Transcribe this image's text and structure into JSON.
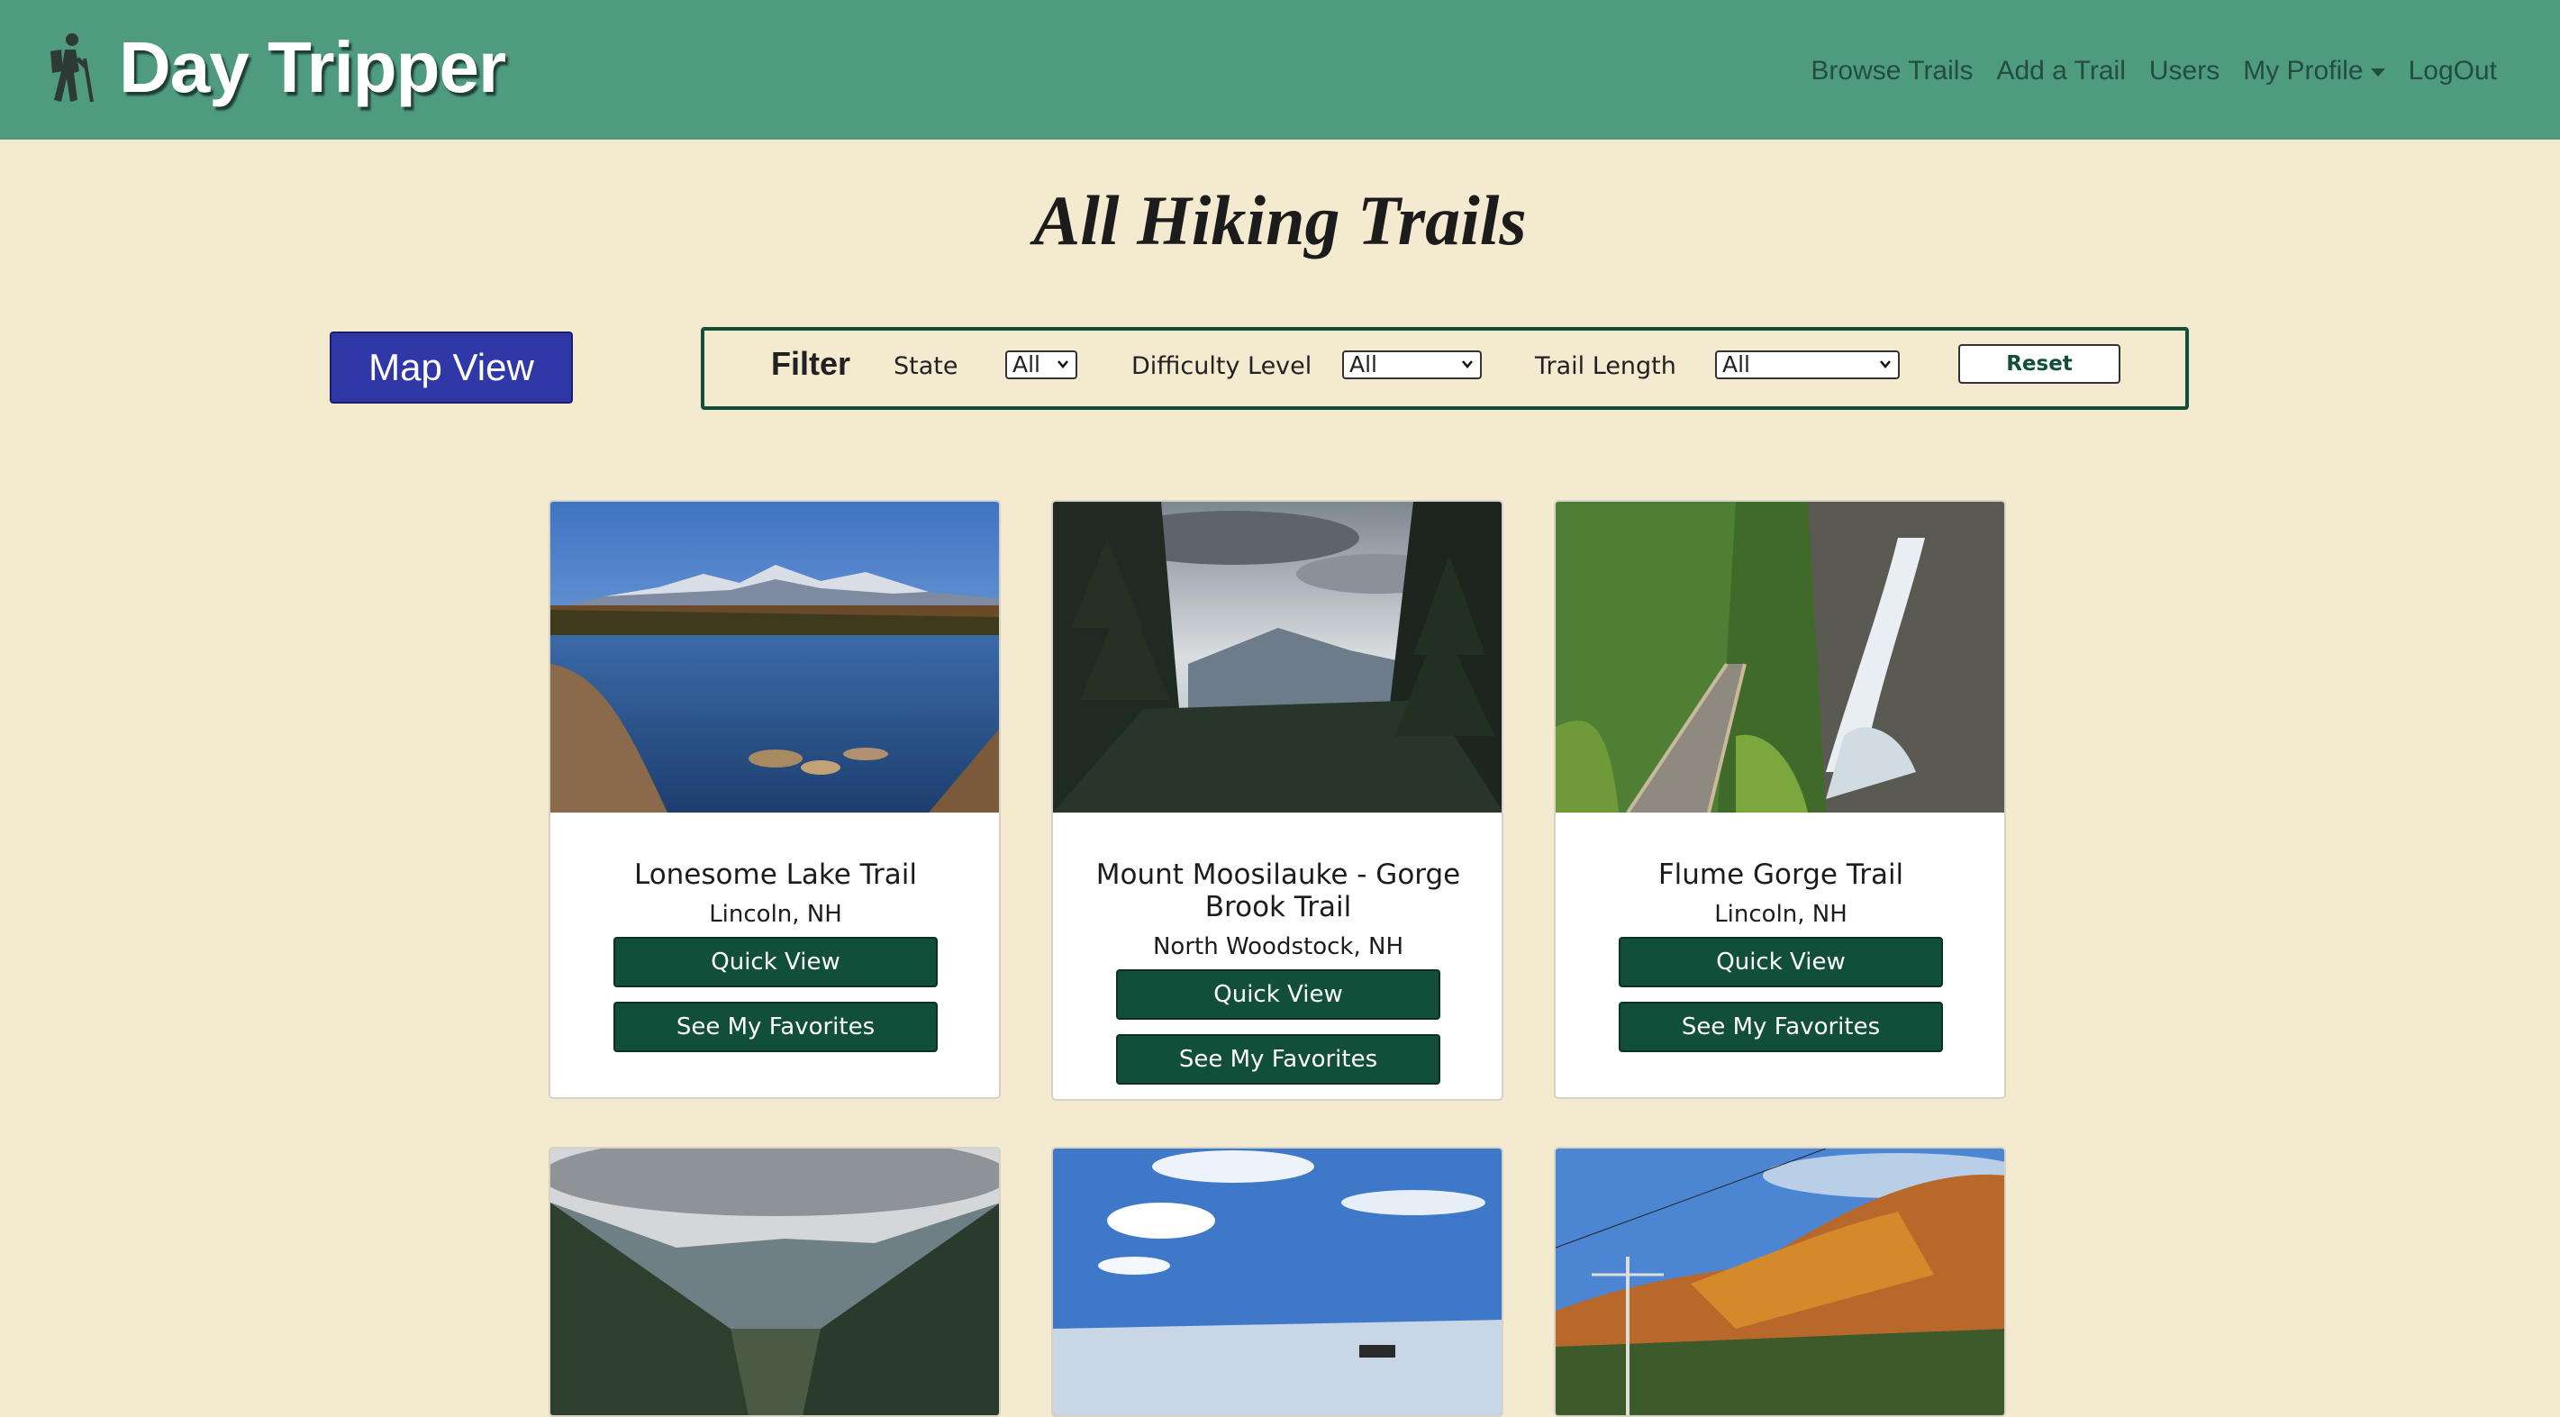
{
  "navbar": {
    "brand": "Day Tripper",
    "brand_icon": "hiker-icon",
    "links": [
      {
        "label": "Browse Trails"
      },
      {
        "label": "Add a Trail"
      },
      {
        "label": "Users"
      },
      {
        "label": "My Profile"
      },
      {
        "label": "LogOut"
      }
    ],
    "bg_color": "#4f9b80"
  },
  "page": {
    "title": "All Hiking Trails",
    "map_button": "Map View"
  },
  "filter": {
    "title": "Filter",
    "state_label": "State",
    "state_value": "All",
    "difficulty_label": "Difficulty Level",
    "difficulty_value": "All",
    "length_label": "Trail Length",
    "length_value": "All",
    "reset_label": "Reset"
  },
  "trails": [
    {
      "name": "Lonesome Lake Trail",
      "location": "Lincoln, NH",
      "image": "mountain-lake-photo"
    },
    {
      "name": "Mount Moosilauke - Gorge Brook Trail",
      "location": "North Woodstock, NH",
      "image": "forest-view-photo"
    },
    {
      "name": "Flume Gorge Trail",
      "location": "Lincoln, NH",
      "image": "waterfall-boardwalk-photo"
    },
    {
      "name": "",
      "location": "",
      "image": "mountain-valley-photo"
    },
    {
      "name": "",
      "location": "",
      "image": "blue-sky-photo"
    },
    {
      "name": "",
      "location": "",
      "image": "autumn-powerline-photo"
    }
  ],
  "card_buttons": {
    "quick_view": "Quick View",
    "favorites": "See My Favorites"
  },
  "colors": {
    "page_bg": "#f3ead0",
    "primary_green": "#114f3a",
    "map_button_blue": "#3038a8"
  }
}
